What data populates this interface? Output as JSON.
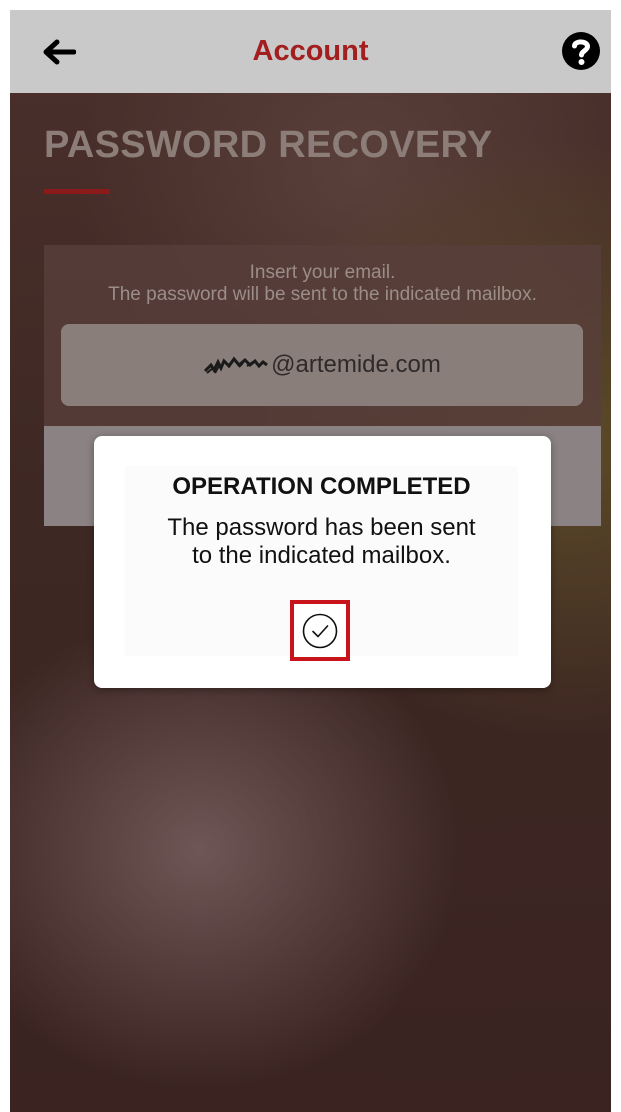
{
  "header": {
    "title": "Account",
    "back_icon": "arrow-left-icon",
    "help_icon": "question-circle-icon"
  },
  "page": {
    "title": "PASSWORD RECOVERY",
    "accent_color": "#8b1b1b"
  },
  "form": {
    "instruction_line1": "Insert your email.",
    "instruction_line2": "The password will be sent to the indicated mailbox.",
    "email_value": "@artemide.com"
  },
  "dialog": {
    "title": "OPERATION COMPLETED",
    "message_line1": "The password has been sent",
    "message_line2": "to the indicated mailbox.",
    "confirm_icon": "check-circle-icon",
    "highlight_color": "#c8131b"
  }
}
